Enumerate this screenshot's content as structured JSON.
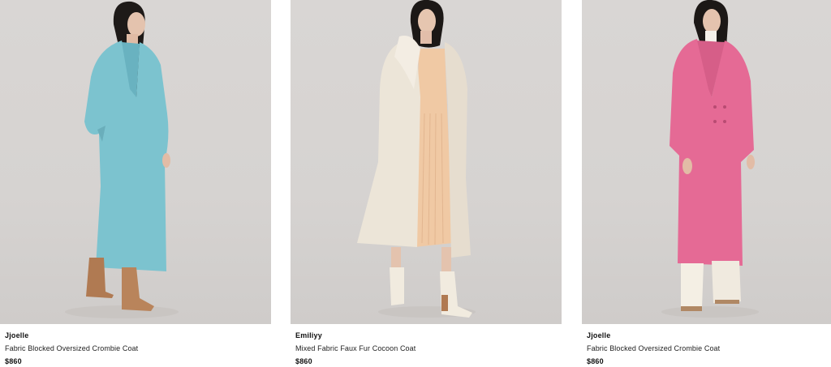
{
  "products": [
    {
      "name": "Jjoelle",
      "description": "Fabric Blocked Oversized Crombie Coat",
      "price": "$860",
      "coat_color": "#7cc3cf",
      "image_alt": "Model wearing a blue oversized crombie coat with tan boots"
    },
    {
      "name": "Emiliyy",
      "description": "Mixed Fabric Faux Fur Cocoon Coat",
      "price": "$860",
      "coat_color": "#ece5d8",
      "image_alt": "Model wearing a cream faux fur cocoon coat with white boots"
    },
    {
      "name": "Jjoelle",
      "description": "Fabric Blocked Oversized Crombie Coat",
      "price": "$860",
      "coat_color": "#e56a95",
      "image_alt": "Model wearing a pink oversized crombie coat with cream trousers"
    }
  ]
}
